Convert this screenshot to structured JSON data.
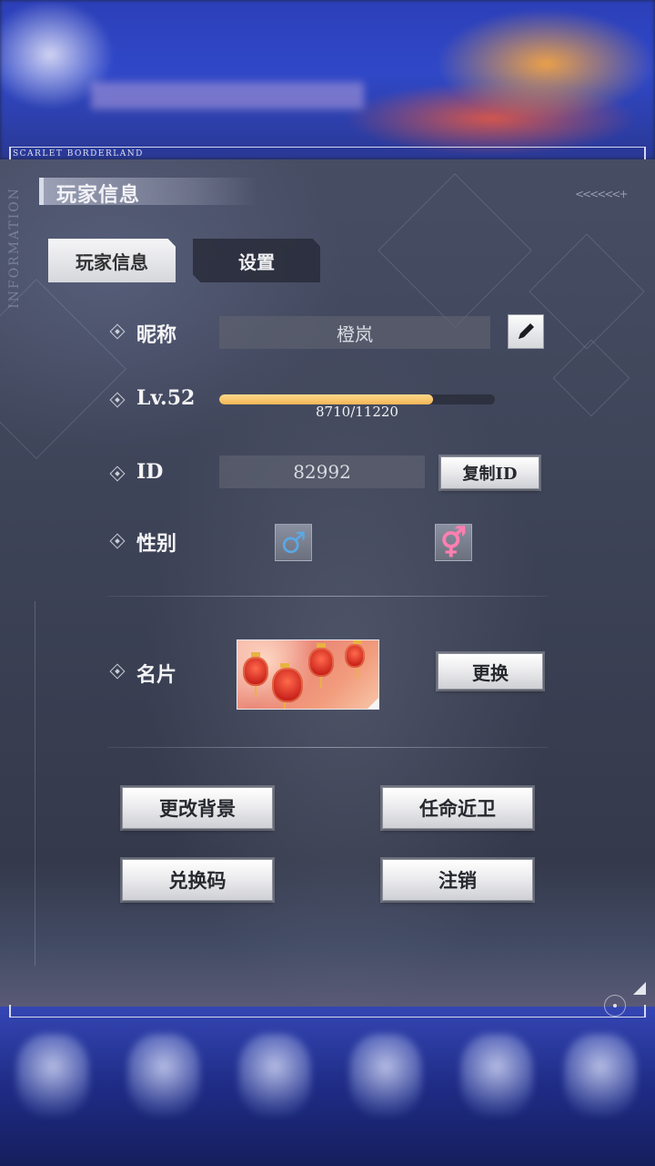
{
  "app": {
    "brand": "SCARLET BORDERLAND",
    "side_label": "INFORMATION"
  },
  "header": {
    "title": "玩家信息",
    "arrows": "<<<<<<+"
  },
  "tabs": [
    {
      "label": "玩家信息",
      "active": true
    },
    {
      "label": "设置",
      "active": false
    }
  ],
  "profile": {
    "nickname_label": "昵称",
    "nickname_value": "橙岚",
    "level_label": "Lv.52",
    "exp_text": "8710/11220",
    "exp_fraction": 0.776,
    "id_label": "ID",
    "id_value": "82992",
    "copy_id_button": "复制ID",
    "gender_label": "性别",
    "male_symbol": "♂",
    "female_symbol": "⚥",
    "card_label": "名片",
    "change_card_button": "更换"
  },
  "actions": {
    "change_background": "更改背景",
    "appoint_guard": "任命近卫",
    "redeem_code": "兑换码",
    "logout": "注销"
  },
  "colors": {
    "exp_fill": "#f4b657",
    "male": "#5aa8e6",
    "female": "#ff7fb0"
  }
}
